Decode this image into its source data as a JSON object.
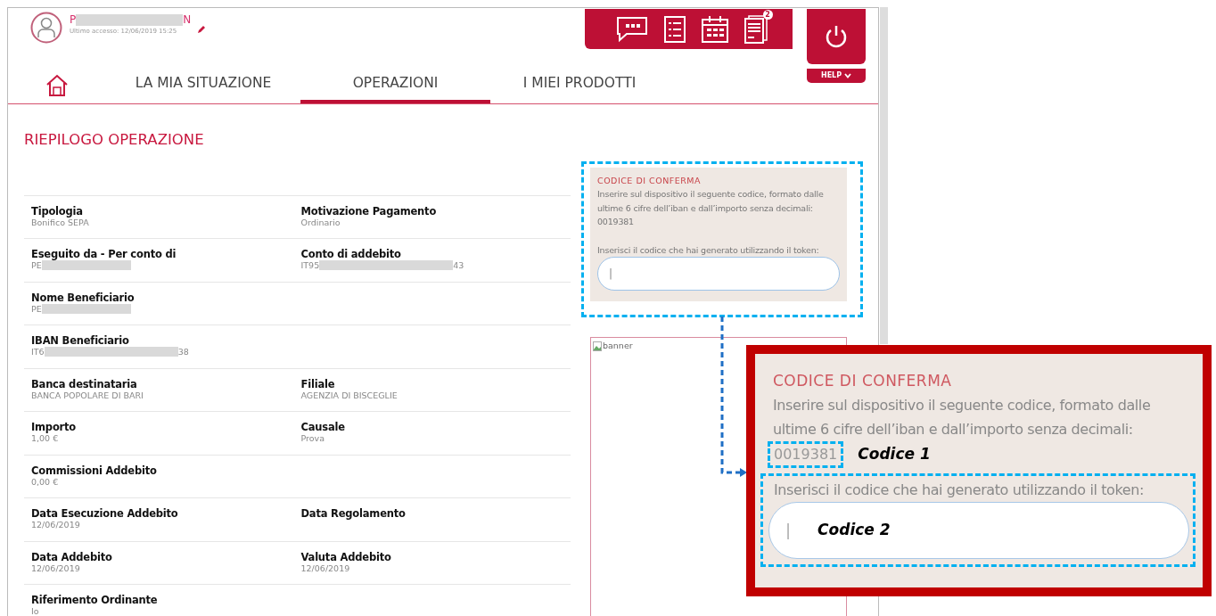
{
  "user": {
    "name_start": "P",
    "name_end": "N",
    "redacted": true,
    "last_access": "Ultimo accesso: 12/06/2019 15:25"
  },
  "toolbar": {
    "badge": "2"
  },
  "help": "HELP",
  "tabs": [
    {
      "label": "LA MIA SITUAZIONE",
      "selected": false
    },
    {
      "label": "OPERAZIONI",
      "selected": true
    },
    {
      "label": "I MIEI PRODOTTI",
      "selected": false
    }
  ],
  "page_title": "RIEPILOGO OPERAZIONE",
  "rows": [
    {
      "cells": [
        {
          "label": "Tipologia",
          "value": "Bonifico SEPA"
        },
        {
          "label": "Motivazione Pagamento",
          "value": "Ordinario"
        }
      ]
    },
    {
      "cells": [
        {
          "label": "Eseguito da - Per conto di",
          "value": "PE",
          "redacted": true
        },
        {
          "label": "Conto di addebito",
          "value": "IT95",
          "value_end": "43",
          "redacted": true
        }
      ]
    },
    {
      "cells": [
        {
          "label": "Nome Beneficiario",
          "value": "PE",
          "redacted": true
        }
      ]
    },
    {
      "cells": [
        {
          "label": "IBAN Beneficiario",
          "value": "IT6",
          "value_end": "38",
          "redacted": true
        }
      ]
    },
    {
      "cells": [
        {
          "label": "Banca destinataria",
          "value": "BANCA POPOLARE DI BARI"
        },
        {
          "label": "Filiale",
          "value": "AGENZIA DI BISCEGLIE"
        }
      ]
    },
    {
      "cells": [
        {
          "label": "Importo",
          "value": "1,00 €"
        },
        {
          "label": "Causale",
          "value": "Prova"
        }
      ]
    },
    {
      "cells": [
        {
          "label": "Commissioni Addebito",
          "value": "0,00 €"
        }
      ]
    },
    {
      "cells": [
        {
          "label": "Data Esecuzione Addebito",
          "value": "12/06/2019"
        },
        {
          "label": "Data Regolamento"
        }
      ]
    },
    {
      "cells": [
        {
          "label": "Data Addebito",
          "value": "12/06/2019"
        },
        {
          "label": "Valuta Addebito",
          "value": "12/06/2019"
        }
      ]
    },
    {
      "cells": [
        {
          "label": "Riferimento Ordinante",
          "value": "Io"
        }
      ]
    }
  ],
  "confirm": {
    "title": "CODICE DI CONFERMA",
    "text": "Inserire sul dispositivo il seguente codice, formato dalle ultime 6 cifre dell’iban e dall’importo senza decimali:",
    "code": "0019381",
    "prompt": "Inserisci il codice che hai generato utilizzando il token:",
    "cursor": "|"
  },
  "banner": "banner",
  "callout": {
    "title": "CODICE DI CONFERMA",
    "text": "Inserire sul dispositivo il seguente codice, formato dalle ultime 6 cifre dell’iban e dall’importo senza decimali:",
    "code": "0019381",
    "code_note": "Codice 1",
    "prompt": "Inserisci il codice che hai generato utilizzando il token:",
    "cursor": "|",
    "field_note": "Codice 2"
  }
}
